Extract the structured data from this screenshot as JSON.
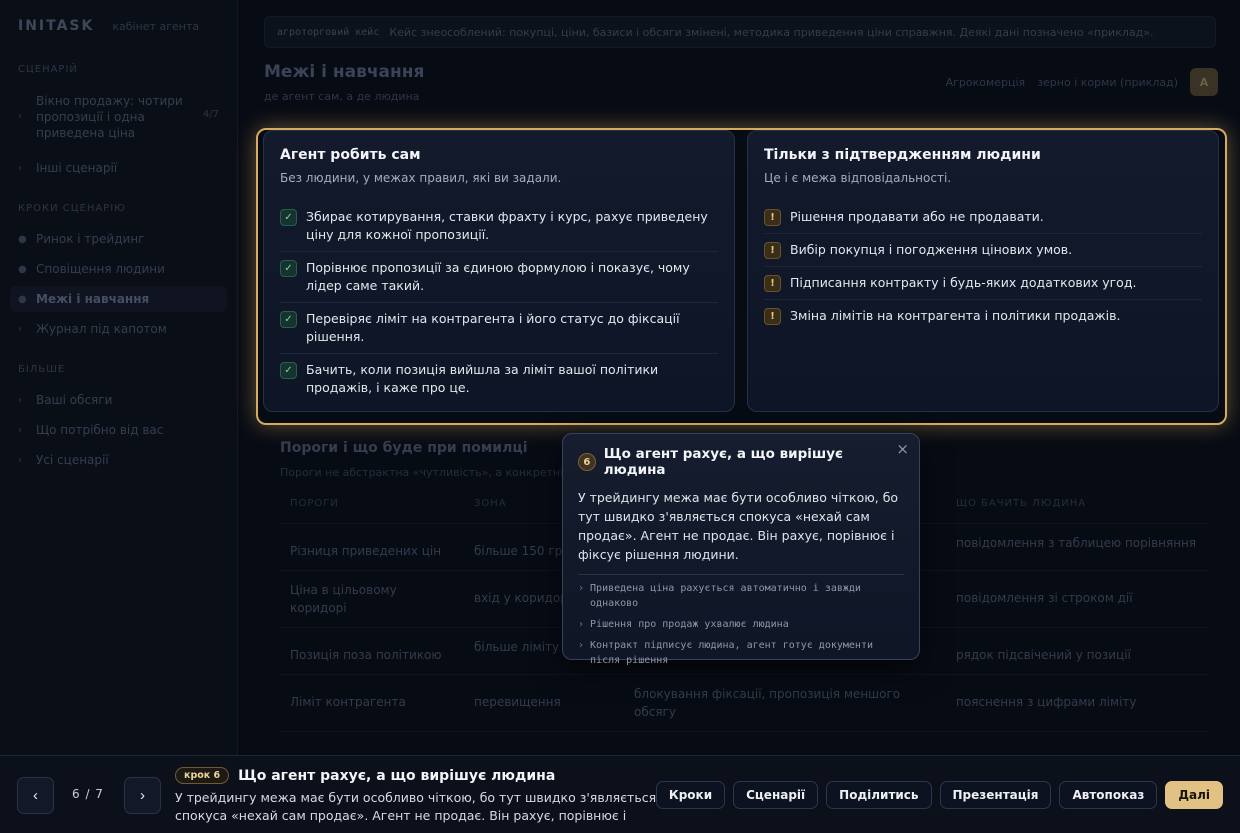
{
  "sidebar": {
    "brand": "INITASK",
    "brand_sub": "кабінет агента",
    "section1": "сценарій",
    "scenario_item": "Вікно продажу: чотири пропозиції і одна приведена ціна",
    "scenario_count": "4/7",
    "other_scenarios": "Інші сценарії",
    "section2": "кроки сценарію",
    "steps": [
      {
        "label": "Ринок і трейдинг"
      },
      {
        "label": "Сповіщення людини"
      },
      {
        "label": "Межі і навчання"
      },
      {
        "label": "Журнал під капотом"
      }
    ],
    "section3": "більше",
    "more": [
      {
        "label": "Ваші обсяги"
      },
      {
        "label": "Що потрібно від вас"
      },
      {
        "label": "Усі сценарії"
      }
    ]
  },
  "banner": {
    "tag": "агроторговий кейс",
    "text": "Кейс знеособлений: покупці, ціни, базиси і обсяги змінені, методика приведення ціни справжня. Деякі дані позначено «приклад»."
  },
  "header": {
    "title": "Межі і навчання",
    "subtitle": "де агент сам, а де людина",
    "right_a": "Агрокомерція",
    "right_b": "зерно і корми (приклад)",
    "avatar": "А"
  },
  "cards": {
    "left": {
      "title": "Агент робить сам",
      "subtitle": "Без людини, у межах правил, які ви задали.",
      "items": [
        "Збирає котирування, ставки фрахту і курс, рахує приведену ціну для кожної пропозиції.",
        "Порівнює пропозиції за єдиною формулою і показує, чому лідер саме такий.",
        "Перевіряє ліміт на контрагента і його статус до фіксації рішення.",
        "Бачить, коли позиція вийшла за ліміт вашої політики продажів, і каже про це."
      ]
    },
    "right": {
      "title": "Тільки з підтвердженням людини",
      "subtitle": "Це і є межа відповідальності.",
      "items": [
        "Рішення продавати або не продавати.",
        "Вибір покупця і погодження цінових умов.",
        "Підписання контракту і будь-яких додаткових угод.",
        "Зміна лімітів на контрагента і політики продажів."
      ]
    }
  },
  "thresholds": {
    "title": "Пороги і що буде при помилці",
    "subtitle": "Пороги не абстрактна «чутливість», а конкретні значення",
    "headers": [
      "ПОРОГИ",
      "ЗОНА",
      "",
      "ЩО БАЧИТЬ ЛЮДИНА"
    ],
    "rows": [
      [
        "Різниця приведених цін",
        "більше 150 грн/т",
        "",
        "повідомлення з таблицею порівняння"
      ],
      [
        "Ціна в цільовому коридорі",
        "вхід у коридор",
        "",
        "повідомлення зі строком дії"
      ],
      [
        "Позиція поза політикою",
        "більше ліміту на п.п.",
        "",
        "рядок підсвічений у позиції"
      ],
      [
        "Ліміт контрагента",
        "перевищення",
        "блокування фіксації, пропозиція меншого обсягу",
        "пояснення з цифрами ліміту"
      ]
    ]
  },
  "tooltip": {
    "step": "6",
    "title": "Що агент рахує, а що вирішує людина",
    "body": "У трейдингу межа має бути особливо чіткою, бо тут швидко з'являється спокуса «нехай сам продає». Агент не продає. Він рахує, порівнює і фіксує рішення людини.",
    "bullets": [
      "Приведена ціна рахується автоматично і завжди однаково",
      "Рішення про продаж ухвалює людина",
      "Контракт підписує людина, агент готує документи після рішення"
    ],
    "close": "×"
  },
  "bottom": {
    "prev": "‹",
    "next": "›",
    "pager": "6 / 7",
    "step_pill": "крок 6",
    "step_title": "Що агент рахує, а що вирішує людина",
    "step_desc": "У трейдингу межа має бути особливо чіткою, бо тут швидко з'являється спокуса «нехай сам продає». Агент не продає. Він рахує, порівнює і фіксу...",
    "actions": [
      "Кроки",
      "Сценарії",
      "Поділитись",
      "Презентація",
      "Автопоказ",
      "Далі"
    ]
  }
}
